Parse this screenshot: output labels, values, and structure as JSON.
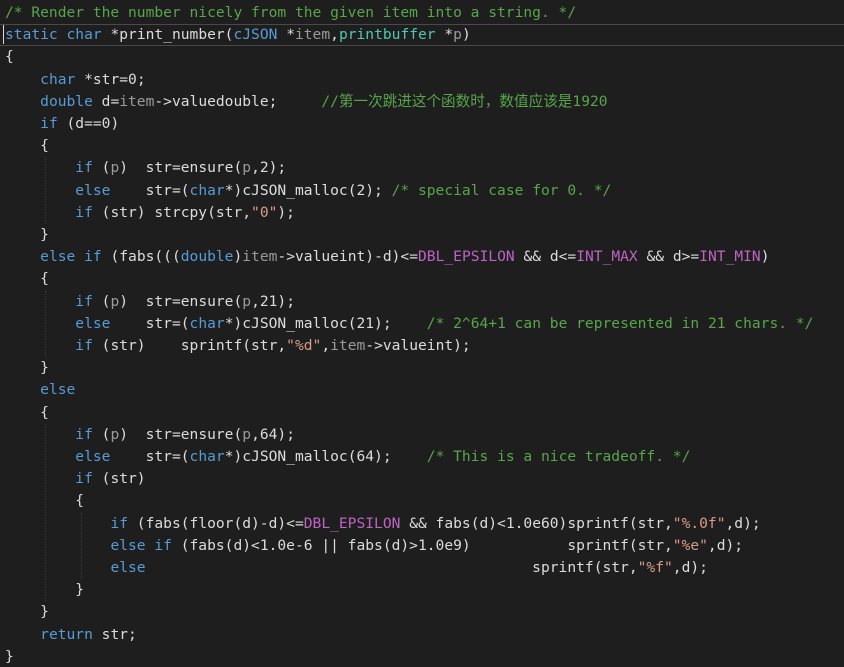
{
  "code": {
    "lines": [
      [
        {
          "c": "cmt",
          "t": "/* Render the number nicely from the given item into a string. */"
        }
      ],
      [
        {
          "c": "kw",
          "t": "static"
        },
        {
          "c": "txt",
          "t": " "
        },
        {
          "c": "kw",
          "t": "char"
        },
        {
          "c": "txt",
          "t": " *print_number("
        },
        {
          "c": "kw",
          "t": "cJSON"
        },
        {
          "c": "txt",
          "t": " *"
        },
        {
          "c": "prm",
          "t": "item"
        },
        {
          "c": "txt",
          "t": ","
        },
        {
          "c": "typ",
          "t": "printbuffer"
        },
        {
          "c": "txt",
          "t": " *"
        },
        {
          "c": "prm",
          "t": "p"
        },
        {
          "c": "txt",
          "t": ")"
        }
      ],
      [
        {
          "c": "txt",
          "t": "{"
        }
      ],
      [
        {
          "c": "txt",
          "t": "    "
        },
        {
          "c": "kw",
          "t": "char"
        },
        {
          "c": "txt",
          "t": " *str=0;"
        }
      ],
      [
        {
          "c": "txt",
          "t": "    "
        },
        {
          "c": "kw",
          "t": "double"
        },
        {
          "c": "txt",
          "t": " d="
        },
        {
          "c": "prm",
          "t": "item"
        },
        {
          "c": "txt",
          "t": "->valuedouble;     "
        },
        {
          "c": "cmt",
          "t": "//第一次跳进这个函数时，数值应该是1920"
        }
      ],
      [
        {
          "c": "txt",
          "t": "    "
        },
        {
          "c": "kw",
          "t": "if"
        },
        {
          "c": "txt",
          "t": " (d==0)"
        }
      ],
      [
        {
          "c": "txt",
          "t": "    {"
        }
      ],
      [
        {
          "c": "txt",
          "t": "        "
        },
        {
          "c": "kw",
          "t": "if"
        },
        {
          "c": "txt",
          "t": " ("
        },
        {
          "c": "prm",
          "t": "p"
        },
        {
          "c": "txt",
          "t": ")  str=ensure("
        },
        {
          "c": "prm",
          "t": "p"
        },
        {
          "c": "txt",
          "t": ",2);"
        }
      ],
      [
        {
          "c": "txt",
          "t": "        "
        },
        {
          "c": "kw",
          "t": "else"
        },
        {
          "c": "txt",
          "t": "    str=("
        },
        {
          "c": "kw",
          "t": "char"
        },
        {
          "c": "txt",
          "t": "*)cJSON_malloc(2); "
        },
        {
          "c": "cmt",
          "t": "/* special case for 0. */"
        }
      ],
      [
        {
          "c": "txt",
          "t": "        "
        },
        {
          "c": "kw",
          "t": "if"
        },
        {
          "c": "txt",
          "t": " (str) strcpy(str,"
        },
        {
          "c": "str",
          "t": "\"0\""
        },
        {
          "c": "txt",
          "t": ");"
        }
      ],
      [
        {
          "c": "txt",
          "t": "    }"
        }
      ],
      [
        {
          "c": "txt",
          "t": "    "
        },
        {
          "c": "kw",
          "t": "else if"
        },
        {
          "c": "txt",
          "t": " (fabs((("
        },
        {
          "c": "kw",
          "t": "double"
        },
        {
          "c": "txt",
          "t": ")"
        },
        {
          "c": "prm",
          "t": "item"
        },
        {
          "c": "txt",
          "t": "->valueint)-d)<="
        },
        {
          "c": "mac",
          "t": "DBL_EPSILON"
        },
        {
          "c": "txt",
          "t": " && d<="
        },
        {
          "c": "mac",
          "t": "INT_MAX"
        },
        {
          "c": "txt",
          "t": " && d>="
        },
        {
          "c": "mac",
          "t": "INT_MIN"
        },
        {
          "c": "txt",
          "t": ")"
        }
      ],
      [
        {
          "c": "txt",
          "t": "    {"
        }
      ],
      [
        {
          "c": "txt",
          "t": "        "
        },
        {
          "c": "kw",
          "t": "if"
        },
        {
          "c": "txt",
          "t": " ("
        },
        {
          "c": "prm",
          "t": "p"
        },
        {
          "c": "txt",
          "t": ")  str=ensure("
        },
        {
          "c": "prm",
          "t": "p"
        },
        {
          "c": "txt",
          "t": ",21);"
        }
      ],
      [
        {
          "c": "txt",
          "t": "        "
        },
        {
          "c": "kw",
          "t": "else"
        },
        {
          "c": "txt",
          "t": "    str=("
        },
        {
          "c": "kw",
          "t": "char"
        },
        {
          "c": "txt",
          "t": "*)cJSON_malloc(21);    "
        },
        {
          "c": "cmt",
          "t": "/* 2^64+1 can be represented in 21 chars. */"
        }
      ],
      [
        {
          "c": "txt",
          "t": "        "
        },
        {
          "c": "kw",
          "t": "if"
        },
        {
          "c": "txt",
          "t": " (str)    sprintf(str,"
        },
        {
          "c": "str",
          "t": "\"%d\""
        },
        {
          "c": "txt",
          "t": ","
        },
        {
          "c": "prm",
          "t": "item"
        },
        {
          "c": "txt",
          "t": "->valueint);"
        }
      ],
      [
        {
          "c": "txt",
          "t": "    }"
        }
      ],
      [
        {
          "c": "txt",
          "t": "    "
        },
        {
          "c": "kw",
          "t": "else"
        }
      ],
      [
        {
          "c": "txt",
          "t": "    {"
        }
      ],
      [
        {
          "c": "txt",
          "t": "        "
        },
        {
          "c": "kw",
          "t": "if"
        },
        {
          "c": "txt",
          "t": " ("
        },
        {
          "c": "prm",
          "t": "p"
        },
        {
          "c": "txt",
          "t": ")  str=ensure("
        },
        {
          "c": "prm",
          "t": "p"
        },
        {
          "c": "txt",
          "t": ",64);"
        }
      ],
      [
        {
          "c": "txt",
          "t": "        "
        },
        {
          "c": "kw",
          "t": "else"
        },
        {
          "c": "txt",
          "t": "    str=("
        },
        {
          "c": "kw",
          "t": "char"
        },
        {
          "c": "txt",
          "t": "*)cJSON_malloc(64);    "
        },
        {
          "c": "cmt",
          "t": "/* This is a nice tradeoff. */"
        }
      ],
      [
        {
          "c": "txt",
          "t": "        "
        },
        {
          "c": "kw",
          "t": "if"
        },
        {
          "c": "txt",
          "t": " (str)"
        }
      ],
      [
        {
          "c": "txt",
          "t": "        {"
        }
      ],
      [
        {
          "c": "txt",
          "t": "            "
        },
        {
          "c": "kw",
          "t": "if"
        },
        {
          "c": "txt",
          "t": " (fabs(floor(d)-d)<="
        },
        {
          "c": "mac",
          "t": "DBL_EPSILON"
        },
        {
          "c": "txt",
          "t": " && fabs(d)<1.0e60)sprintf(str,"
        },
        {
          "c": "str",
          "t": "\"%.0f\""
        },
        {
          "c": "txt",
          "t": ",d);"
        }
      ],
      [
        {
          "c": "txt",
          "t": "            "
        },
        {
          "c": "kw",
          "t": "else if"
        },
        {
          "c": "txt",
          "t": " (fabs(d)<1.0e-6 || fabs(d)>1.0e9)           sprintf(str,"
        },
        {
          "c": "str",
          "t": "\"%e\""
        },
        {
          "c": "txt",
          "t": ",d);"
        }
      ],
      [
        {
          "c": "txt",
          "t": "            "
        },
        {
          "c": "kw",
          "t": "else"
        },
        {
          "c": "txt",
          "t": "                                            sprintf(str,"
        },
        {
          "c": "str",
          "t": "\"%f\""
        },
        {
          "c": "txt",
          "t": ",d);"
        }
      ],
      [
        {
          "c": "txt",
          "t": "        }"
        }
      ],
      [
        {
          "c": "txt",
          "t": "    }"
        }
      ],
      [
        {
          "c": "txt",
          "t": "    "
        },
        {
          "c": "kw",
          "t": "return"
        },
        {
          "c": "txt",
          "t": " str;"
        }
      ],
      [
        {
          "c": "txt",
          "t": "}"
        }
      ]
    ]
  },
  "theme": {
    "background": "#1e1e1e",
    "text": "#dcdcdc",
    "keyword": "#569cd6",
    "comment": "#57a64a",
    "string": "#d69d85",
    "macro": "#bd63c5",
    "parameter": "#9a9a9a",
    "type": "#4ec9b0"
  }
}
